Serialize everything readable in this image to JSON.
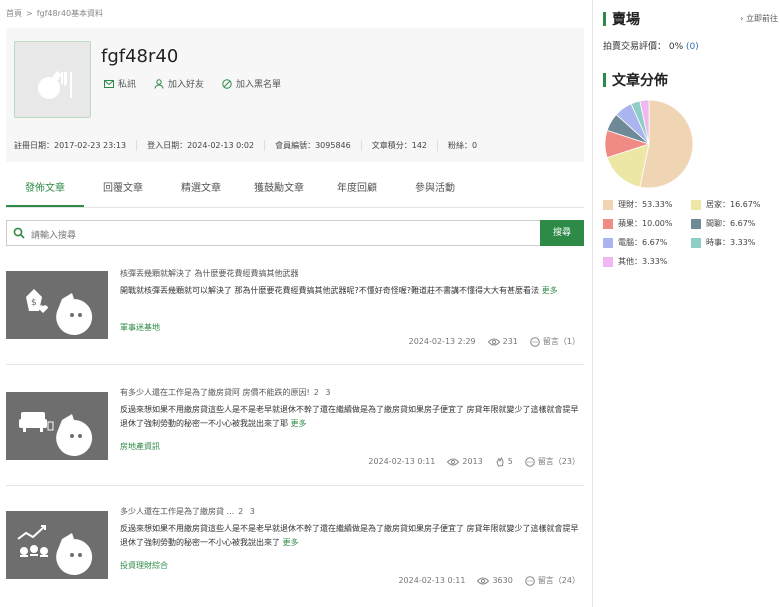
{
  "breadcrumb": {
    "home": "首頁",
    "sep": ">",
    "current": "fgf48r40基本資料"
  },
  "profile": {
    "username": "fgf48r40",
    "actions": {
      "message": "私訊",
      "add_friend": "加入好友",
      "blacklist": "加入黑名單"
    },
    "meta": {
      "register": "註冊日期：2017-02-23 23:13",
      "login": "登入日期：2024-02-13 0:02",
      "member_no": "會員編號：3095846",
      "points": "文章積分：142",
      "fans": "粉絲：0"
    }
  },
  "tabs": [
    {
      "label": "發佈文章",
      "active": true
    },
    {
      "label": "回覆文章"
    },
    {
      "label": "精選文章"
    },
    {
      "label": "獲鼓勵文章"
    },
    {
      "label": "年度回顧"
    },
    {
      "label": "參與活動"
    }
  ],
  "search": {
    "placeholder": "請輸入搜尋",
    "button": "搜尋"
  },
  "posts": [
    {
      "title": "核彈丟幾顆就解決了 為什麼要花費經費搞其他武器",
      "pages": "",
      "excerpt": "開戰就核彈丟幾顆就可以解決了 那為什麼要花費經費搞其他武器呢?不懂好奇怪喔?難道莊不書講不懂得大大有甚麼看法",
      "more": "更多",
      "category": "軍事迷基地",
      "date": "2024-02-13 2:29",
      "views": "231",
      "likes": "",
      "comments": "留言（1）",
      "icon": "money-heart-icon"
    },
    {
      "title": "有多少人還在工作是為了繳房貸阿 房價不能跌的原因!",
      "pages": "2 3",
      "excerpt": "反過來想如果不用繳房貸這些人是不是老早就退休不幹了還在繼續做是為了繳房貸如果房子便宜了 房貸年限就變少了這樣就會提早退休了強制勞動的秘密一不小心被我說出來了耶",
      "more": "更多",
      "category": "房地產資訊",
      "date": "2024-02-13 0:11",
      "views": "2013",
      "likes": "5",
      "comments": "留言（23）",
      "icon": "sofa-icon"
    },
    {
      "title": "多少人還在工作是為了繳房貸 ...",
      "pages": "2 3",
      "excerpt": "反過來想如果不用繳房貸這些人是不是老早就退休不幹了還在繼續做是為了繳房貸如果房子便宜了 房貸年限就變少了這樣就會提早退休了強制勞動的秘密一不小心被我說出來了",
      "more": "更多",
      "category": "投資理財綜合",
      "date": "2024-02-13 0:11",
      "views": "3630",
      "likes": "",
      "comments": "留言（24）",
      "icon": "chart-coins-icon"
    }
  ],
  "sidebar": {
    "market": {
      "title": "賣場",
      "link": "立即前往",
      "rating_label": "拍賣交易評價：",
      "rating_pct": "0%",
      "rating_count": "(0)"
    },
    "distribution": {
      "title": "文章分佈"
    }
  },
  "chart_data": {
    "type": "pie",
    "title": "文章分佈",
    "categories": [
      "理財",
      "居家",
      "蘋果",
      "間聊",
      "電腦",
      "時事",
      "其他"
    ],
    "values": [
      53.33,
      16.67,
      10.0,
      6.67,
      6.67,
      3.33,
      3.33
    ],
    "labels": [
      "理財：53.33%",
      "居家：16.67%",
      "蘋果：10.00%",
      "間聊：6.67%",
      "電腦：6.67%",
      "時事：3.33%",
      "其他：3.33%"
    ],
    "colors": [
      "#efd5b3",
      "#ede7a6",
      "#ef8a84",
      "#6e8a96",
      "#aab4ef",
      "#8fcdc7",
      "#efb8ef"
    ],
    "legend": "bottom"
  }
}
